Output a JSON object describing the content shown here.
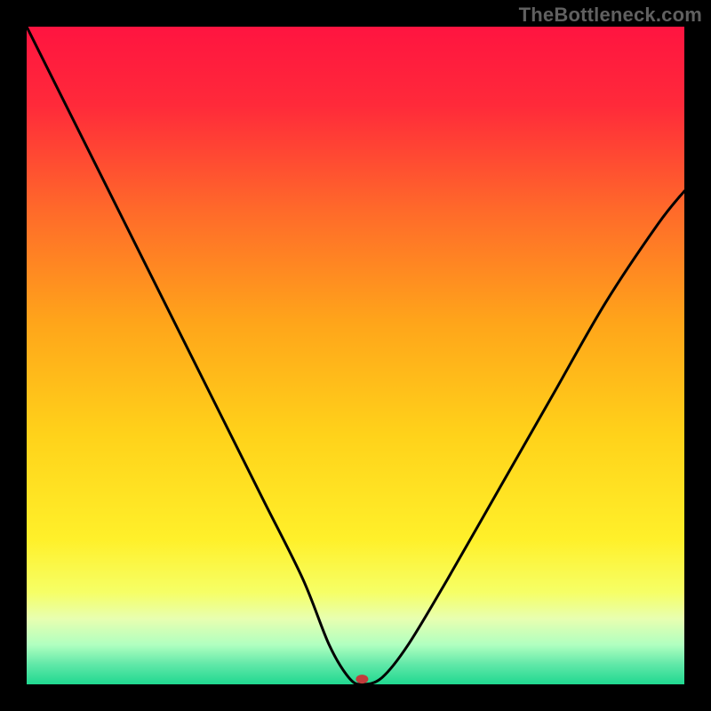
{
  "attribution": "TheBottleneck.com",
  "chart_data": {
    "type": "line",
    "title": "",
    "xlabel": "",
    "ylabel": "",
    "xlim": [
      0,
      100
    ],
    "ylim": [
      0,
      100
    ],
    "grid": false,
    "legend": false,
    "curve": {
      "name": "bottleneck-curve",
      "x": [
        0,
        6,
        12,
        18,
        24,
        30,
        36,
        42,
        46,
        49,
        51,
        54,
        58,
        64,
        72,
        80,
        88,
        96,
        100
      ],
      "y": [
        100,
        88,
        76,
        64,
        52,
        40,
        28,
        16,
        6,
        1,
        0,
        1,
        6,
        16,
        30,
        44,
        58,
        70,
        75
      ]
    },
    "marker": {
      "x": 51,
      "y": 0.8,
      "color": "#c23b3b",
      "rx": 7,
      "ry": 5
    },
    "gradient_stops": [
      {
        "offset": 0.0,
        "color": "#ff1440"
      },
      {
        "offset": 0.12,
        "color": "#ff2a3a"
      },
      {
        "offset": 0.28,
        "color": "#ff6a2a"
      },
      {
        "offset": 0.45,
        "color": "#ffa51a"
      },
      {
        "offset": 0.62,
        "color": "#ffd21a"
      },
      {
        "offset": 0.78,
        "color": "#fff02a"
      },
      {
        "offset": 0.86,
        "color": "#f6ff66"
      },
      {
        "offset": 0.9,
        "color": "#e8ffb0"
      },
      {
        "offset": 0.94,
        "color": "#b0ffc0"
      },
      {
        "offset": 0.97,
        "color": "#60e8a8"
      },
      {
        "offset": 1.0,
        "color": "#20d890"
      }
    ]
  }
}
